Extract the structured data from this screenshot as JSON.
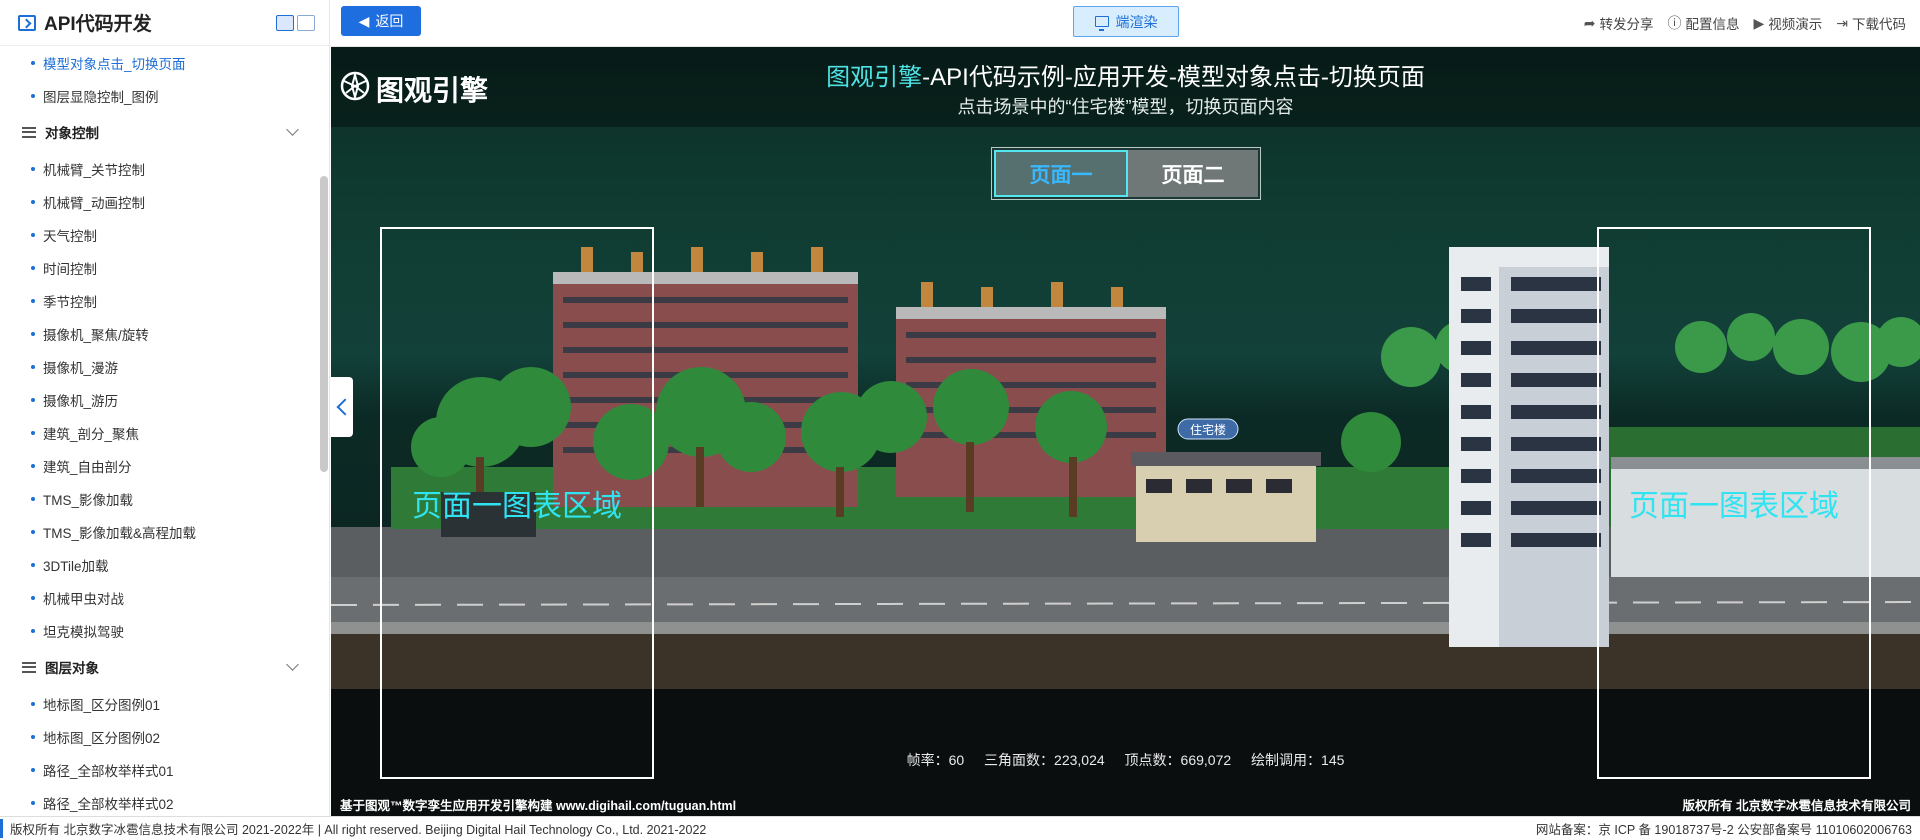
{
  "sidebar": {
    "title": "API代码开发",
    "items_top": [
      {
        "label": "模型对象点击_切换页面",
        "active": true
      },
      {
        "label": "图层显隐控制_图例",
        "active": false
      }
    ],
    "group1": {
      "label": "对象控制",
      "items": [
        "机械臂_关节控制",
        "机械臂_动画控制",
        "天气控制",
        "时间控制",
        "季节控制",
        "摄像机_聚焦/旋转",
        "摄像机_漫游",
        "摄像机_游历",
        "建筑_剖分_聚焦",
        "建筑_自由剖分",
        "TMS_影像加载",
        "TMS_影像加载&高程加载",
        "3DTile加载",
        "机械甲虫对战",
        "坦克模拟驾驶"
      ]
    },
    "group2": {
      "label": "图层对象",
      "items": [
        "地标图_区分图例01",
        "地标图_区分图例02",
        "路径_全部枚举样式01",
        "路径_全部枚举样式02"
      ]
    }
  },
  "topbar": {
    "back_label": "返回",
    "render_label": "端渲染",
    "actions": [
      "转发分享",
      "配置信息",
      "视频演示",
      "下载代码"
    ]
  },
  "scene": {
    "logo_text": "图观引擎",
    "title_highlight": "图观引擎",
    "title_rest": "-API代码示例-应用开发-模型对象点击-切换页面",
    "subtitle": "点击场景中的“住宅楼”模型，切换页面内容",
    "tabs": [
      {
        "label": "页面一",
        "active": true
      },
      {
        "label": "页面二",
        "active": false
      }
    ],
    "chart_left_label": "页面一图表区域",
    "chart_right_label": "页面一图表区域",
    "building_tag": "住宅楼",
    "stats": {
      "fps": "帧率：60",
      "triangles": "三角面数：223,024",
      "vertices": "顶点数：669,072",
      "draw_calls": "绘制调用：145"
    },
    "footer_left": "基于图观™数字孪生应用开发引擎构建 www.digihail.com/tuguan.html",
    "footer_right": "版权所有 北京数字冰雹信息技术有限公司"
  },
  "bottombar": {
    "left": "版权所有 北京数字冰雹信息技术有限公司 2021-2022年 | All right reserved. Beijing Digital Hail Technology Co., Ltd. 2021-2022",
    "right": "网站备案：京 ICP 备 19018737号-2 公安部备案号 11010602006763"
  },
  "colors": {
    "accent": "#1d6fd6",
    "scene_highlight": "#4fe3e8",
    "chart_text": "#2fe4f0"
  }
}
